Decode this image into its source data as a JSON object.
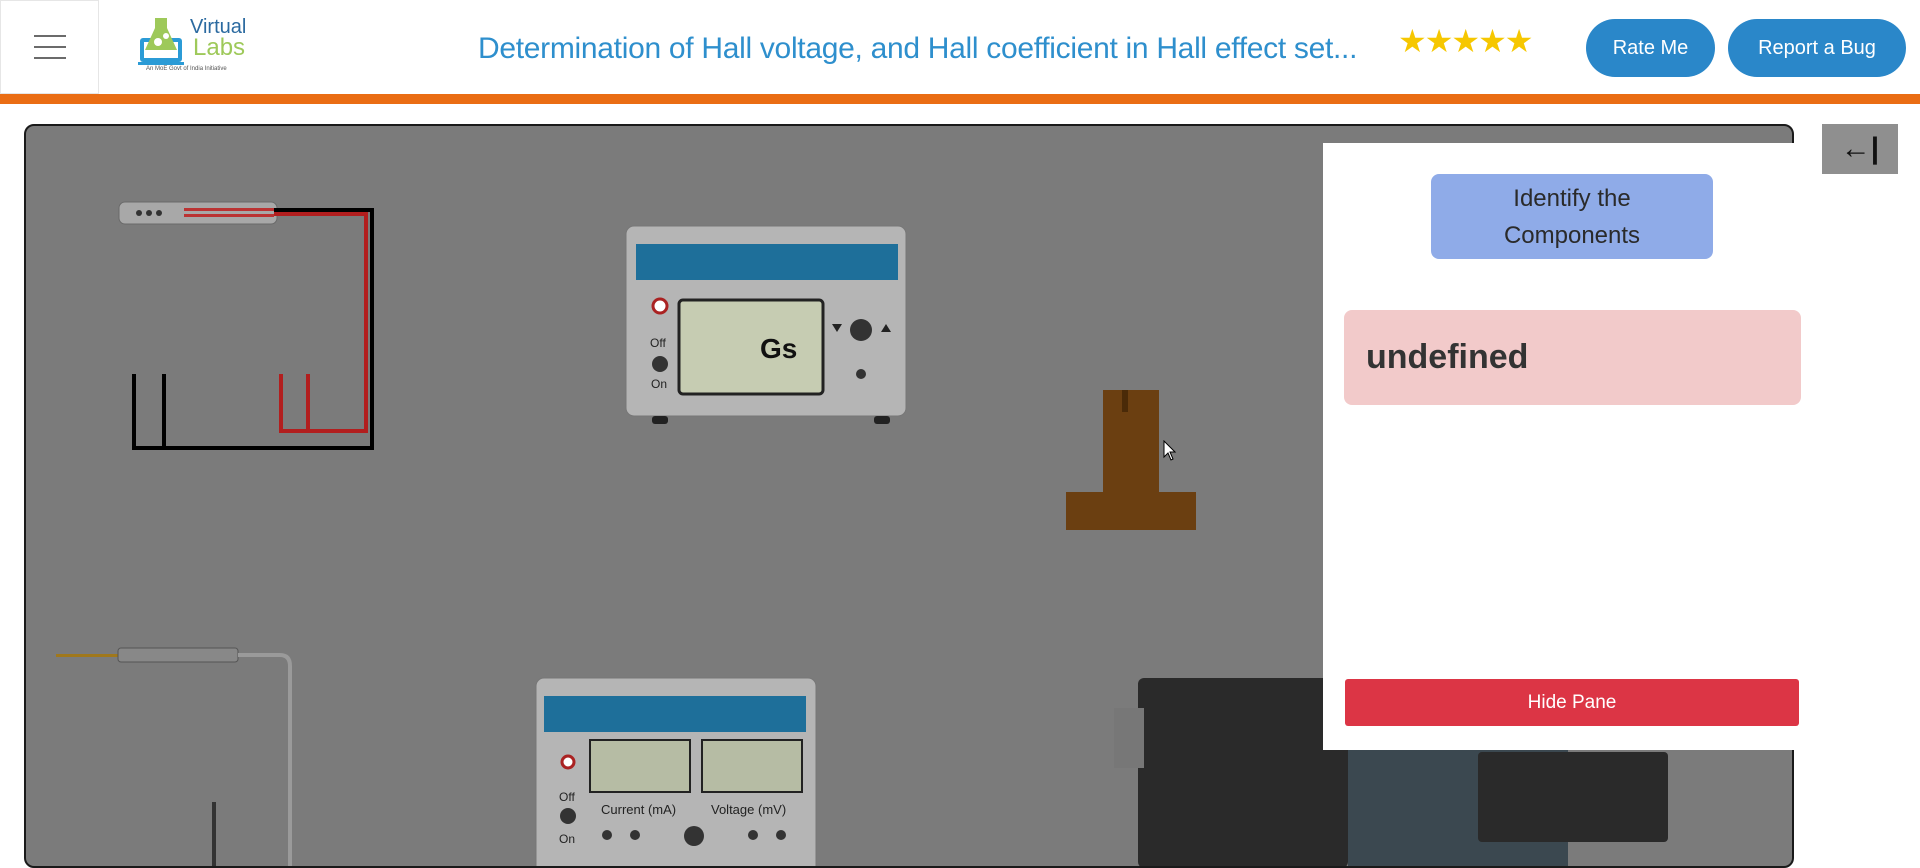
{
  "header": {
    "logo_line1": "Virtual",
    "logo_line2": "Labs",
    "logo_sub": "An MoE Govt of India Initiative",
    "title": "Determination of Hall voltage, and Hall coefficient in Hall effect set...",
    "stars": "★★★★★",
    "rating": 5,
    "rate_label": "Rate Me",
    "bug_label": "Report a Bug"
  },
  "workspace": {
    "gaussmeter_unit": "Gs",
    "gaussmeter_off": "Off",
    "gaussmeter_on": "On",
    "supply_off": "Off",
    "supply_on": "On",
    "current_label": "Current (mA)",
    "voltage_label": "Voltage (mV)"
  },
  "panel": {
    "collapse_icon": "←|",
    "heading_line1": "Identify the",
    "heading_line2": "Components",
    "message": "undefined",
    "hide_label": "Hide Pane"
  },
  "colors": {
    "accent_blue": "#2a87c9",
    "title_blue": "#2e8fcd",
    "orange_bar": "#ea6d14",
    "danger": "#dc3545",
    "heading_bg": "#8fabe8",
    "message_bg": "#f2caca",
    "workspace_bg": "#7b7b7b"
  }
}
